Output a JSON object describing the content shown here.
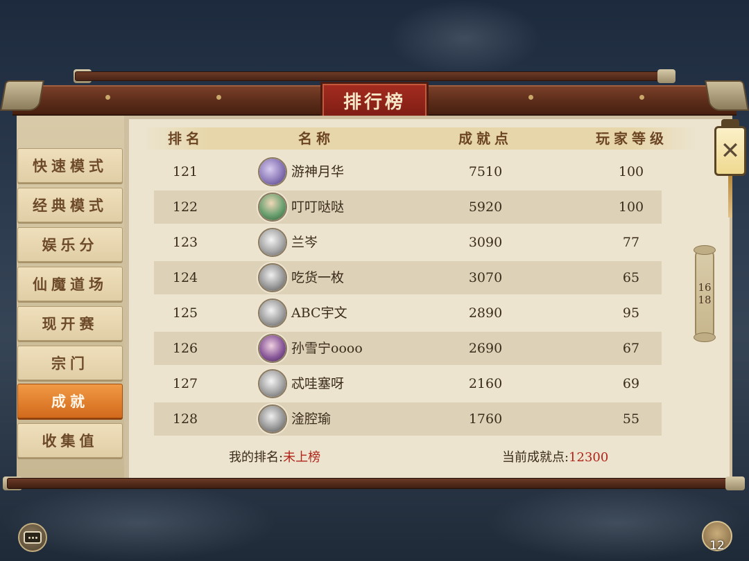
{
  "title": "排行榜",
  "sidebar": {
    "items": [
      {
        "label": "快速模式",
        "active": false
      },
      {
        "label": "经典模式",
        "active": false
      },
      {
        "label": "娱乐分",
        "active": false
      },
      {
        "label": "仙魔道场",
        "active": false
      },
      {
        "label": "现开赛",
        "active": false
      },
      {
        "label": "宗门",
        "active": false
      },
      {
        "label": "成就",
        "active": true
      },
      {
        "label": "收集值",
        "active": false
      }
    ]
  },
  "table": {
    "headers": {
      "rank": "排名",
      "name": "名称",
      "points": "成就点",
      "level": "玩家等级"
    },
    "rows": [
      {
        "rank": "121",
        "name": "游神月华",
        "points": "7510",
        "level": "100",
        "avatar_color": "#8c7ab8"
      },
      {
        "rank": "122",
        "name": "叮叮哒哒",
        "points": "5920",
        "level": "100",
        "avatar_color": "#6aa070"
      },
      {
        "rank": "123",
        "name": "兰岑",
        "points": "3090",
        "level": "77",
        "avatar_color": "#a8a8a8"
      },
      {
        "rank": "124",
        "name": "吃货一枚",
        "points": "3070",
        "level": "65",
        "avatar_color": "#9a9a9a"
      },
      {
        "rank": "125",
        "name": "ABC宇文",
        "points": "2890",
        "level": "95",
        "avatar_color": "#a0a0a0"
      },
      {
        "rank": "126",
        "name": "孙雪宁oooo",
        "points": "2690",
        "level": "67",
        "avatar_color": "#8a5a9a"
      },
      {
        "rank": "127",
        "name": "忒哇塞呀",
        "points": "2160",
        "level": "69",
        "avatar_color": "#a4a4a4"
      },
      {
        "rank": "128",
        "name": "淦腔瑜",
        "points": "1760",
        "level": "55",
        "avatar_color": "#989898"
      }
    ]
  },
  "footer": {
    "my_rank_label": "我的排名:",
    "my_rank_value": "未上榜",
    "points_label": "当前成就点:",
    "points_value": "12300"
  },
  "pager": {
    "current": "16",
    "total": "18"
  },
  "close_label": "✕",
  "bag_count": "12",
  "colors": {
    "accent_active": "#e07c2a",
    "highlight_red": "#b0241a",
    "header_wood": "#5b2c1a"
  }
}
